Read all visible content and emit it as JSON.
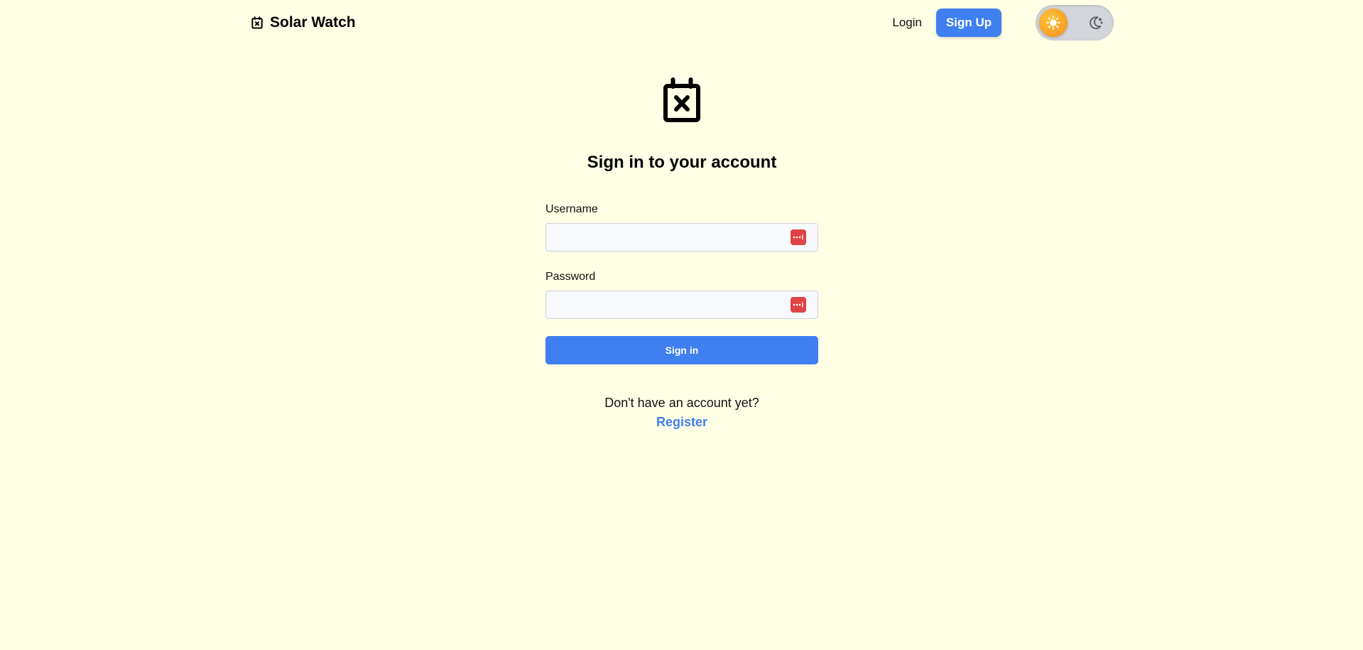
{
  "header": {
    "brand_title": "Solar Watch",
    "brand_icon": "calendar-x-icon",
    "login_label": "Login",
    "signup_label": "Sign Up",
    "theme_toggle": {
      "state": "light",
      "light_icon": "sun-icon",
      "dark_icon": "moon-icon",
      "knob_color": "#f7a224",
      "track_color": "#d3d5db"
    }
  },
  "main": {
    "logo_icon": "calendar-x-icon",
    "title": "Sign in to your account",
    "form": {
      "username_label": "Username",
      "username_value": "",
      "password_label": "Password",
      "password_value": "",
      "field_icon": "password-manager-icon",
      "submit_label": "Sign in"
    },
    "footer": {
      "prompt": "Don't have an account yet?",
      "register_label": "Register"
    }
  },
  "colors": {
    "background": "#ffffe6",
    "accent": "#3f7ff0",
    "field_icon": "#e04343"
  }
}
